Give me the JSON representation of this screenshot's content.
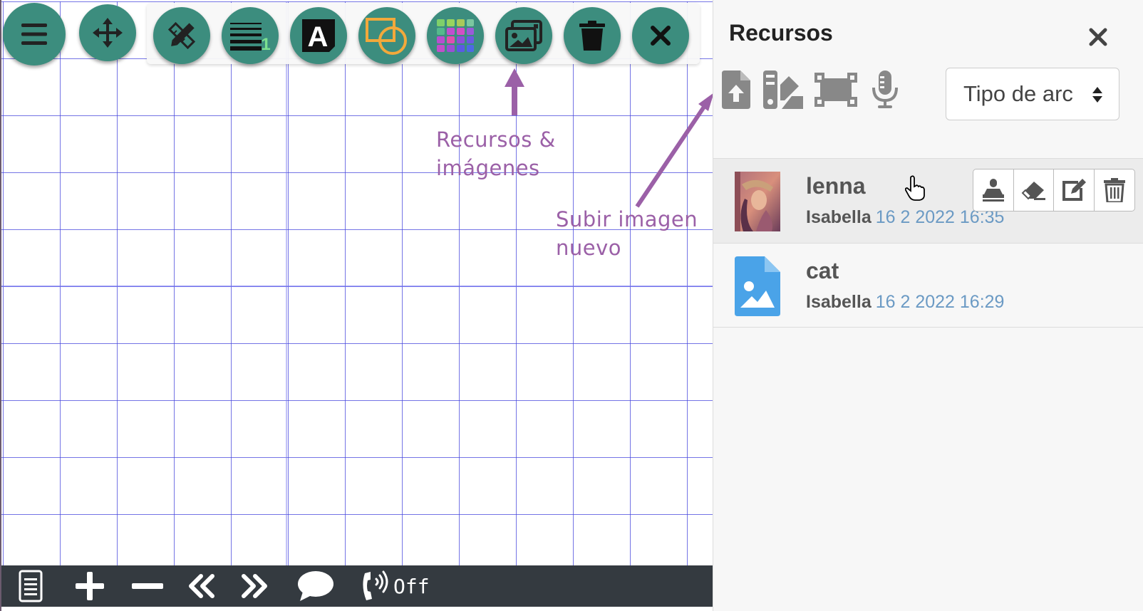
{
  "panel": {
    "title": "Recursos",
    "close_icon": "times-icon",
    "toolbar_icons": [
      "file-upload-icon",
      "swatchbook-icon",
      "crop-icon",
      "microphone-icon"
    ],
    "file_type_select": {
      "value": "Tipo de arc"
    },
    "items": [
      {
        "name": "lenna",
        "owner": "Isabella",
        "date": "16 2 2022 16:35",
        "thumbnail": "photo-thumbnail",
        "active": true,
        "actions": [
          "stamp-icon",
          "eraser-icon",
          "edit-icon",
          "trash-icon"
        ]
      },
      {
        "name": "cat",
        "owner": "Isabella",
        "date": "16 2 2022 16:29",
        "thumbnail": "image-file-icon",
        "active": false
      }
    ]
  },
  "toolbar": {
    "buttons": [
      "menu-icon",
      "move-icon",
      "pencil-ruler-icon",
      "line-width-icon",
      "text-icon",
      "shapes-icon",
      "color-grid-icon",
      "images-icon",
      "trash-icon",
      "close-icon"
    ],
    "line_width_value": "1",
    "text_icon_letter": "A"
  },
  "annotations": {
    "resources_line1": "Recursos &",
    "resources_line2": "imágenes",
    "upload_line1": "Subir imagen",
    "upload_line2": "nuevo"
  },
  "bottombar": {
    "items": [
      "page-icon",
      "plus-icon",
      "minus-icon",
      "double-left-icon",
      "double-right-icon",
      "chat-icon",
      "phone-volume-icon"
    ],
    "call_status": "Off"
  },
  "colors": {
    "toolbar_button": "#3c8d7e",
    "annotation": "#9b60a7",
    "bottombar": "#343a40",
    "grid_line": "#4646dc",
    "date_text": "#6b9ac4"
  }
}
